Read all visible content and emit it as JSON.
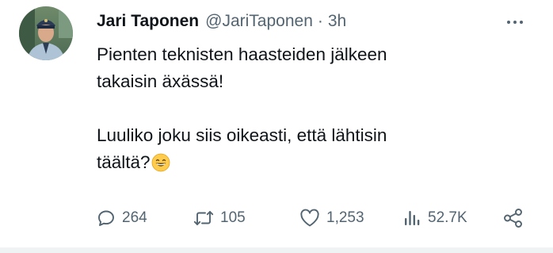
{
  "tweet": {
    "author_name": "Jari Taponen",
    "author_handle": "@JariTaponen",
    "separator": "·",
    "time": "3h",
    "lines_para1": [
      "Pienten teknisten haasteiden jälkeen",
      "takaisin äxässä!"
    ],
    "lines_para2": [
      "Luuliko joku siis oikeasti, että lähtisin",
      "täältä?"
    ],
    "emoji": "grinning-face-with-smiling-eyes"
  },
  "actions": {
    "replies": "264",
    "reposts": "105",
    "likes": "1,253",
    "views": "52.7K"
  },
  "icons": {
    "reply": "reply-icon",
    "repost": "repost-icon",
    "like": "heart-icon",
    "views": "views-icon",
    "share": "share-icon",
    "more": "more-icon"
  },
  "colors": {
    "text": "#0f1419",
    "secondary": "#536471",
    "divider": "#eff3f4"
  }
}
